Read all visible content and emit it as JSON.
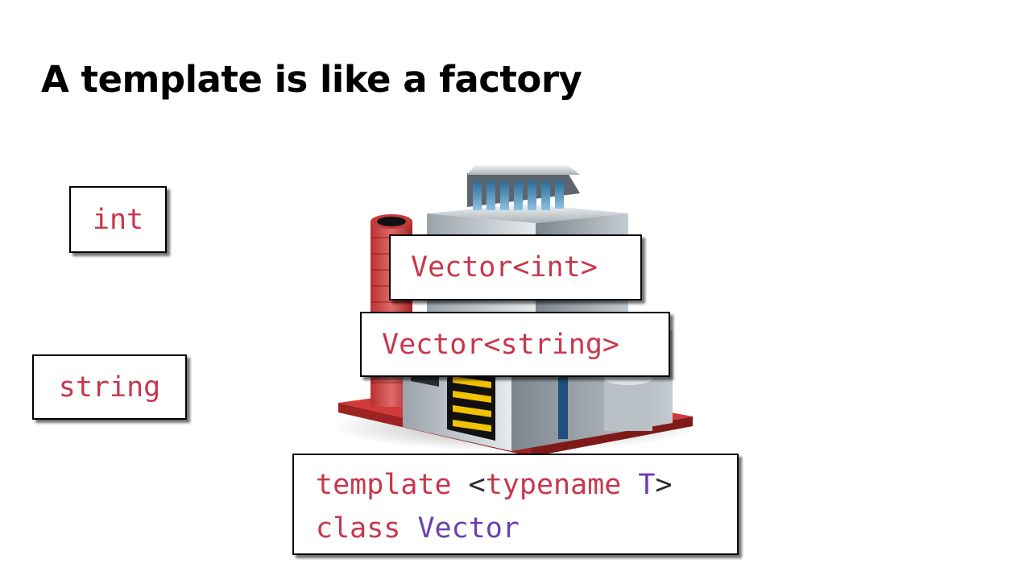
{
  "slide": {
    "title": "A template is like a factory"
  },
  "inputs": {
    "int_label": "int",
    "string_label": "string"
  },
  "outputs": {
    "vector_int": "Vector<int>",
    "vector_string": "Vector<string>"
  },
  "code": {
    "line1": {
      "keyword": "template",
      "open": "<",
      "typename": "typename",
      "param": "T",
      "close": ">"
    },
    "line2": {
      "keyword": "class",
      "name": "Vector"
    }
  },
  "colors": {
    "keyword": "#c8374c",
    "type": "#6b3fb0",
    "text": "#2a2a2a"
  },
  "icons": {
    "factory": "factory-building-icon"
  }
}
